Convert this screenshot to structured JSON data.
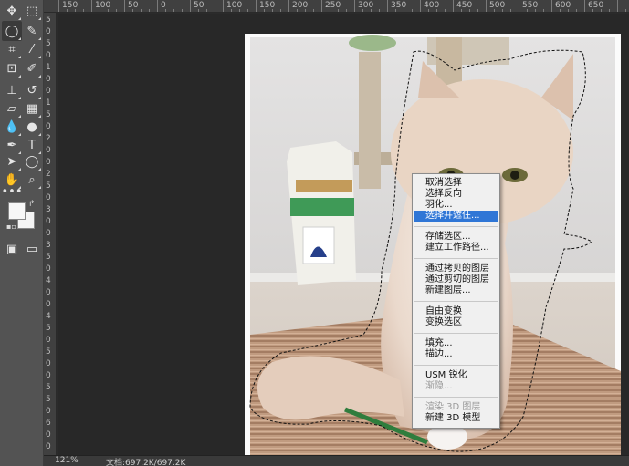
{
  "toolbar": {
    "tools": [
      {
        "name": "move-tool",
        "glyph": "✥"
      },
      {
        "name": "marquee-tool",
        "glyph": "⬚"
      },
      {
        "name": "lasso-tool",
        "glyph": "◯"
      },
      {
        "name": "quick-select-tool",
        "glyph": "✎"
      },
      {
        "name": "crop-tool",
        "glyph": "⌗"
      },
      {
        "name": "eyedropper-tool",
        "glyph": "⁄"
      },
      {
        "name": "healing-tool",
        "glyph": "⊡"
      },
      {
        "name": "brush-tool",
        "glyph": "✐"
      },
      {
        "name": "stamp-tool",
        "glyph": "⊥"
      },
      {
        "name": "history-brush-tool",
        "glyph": "↺"
      },
      {
        "name": "eraser-tool",
        "glyph": "▱"
      },
      {
        "name": "gradient-tool",
        "glyph": "▦"
      },
      {
        "name": "blur-tool",
        "glyph": "💧"
      },
      {
        "name": "dodge-tool",
        "glyph": "●"
      },
      {
        "name": "pen-tool",
        "glyph": "✒"
      },
      {
        "name": "type-tool",
        "glyph": "T"
      },
      {
        "name": "path-select-tool",
        "glyph": "➤"
      },
      {
        "name": "shape-tool",
        "glyph": "◯"
      },
      {
        "name": "hand-tool",
        "glyph": "✋"
      },
      {
        "name": "zoom-tool",
        "glyph": "⌕"
      },
      {
        "name": "more-tools",
        "glyph": "•••"
      },
      {
        "name": "quick-mask-tool",
        "glyph": "▣"
      },
      {
        "name": "screen-mode-tool",
        "glyph": "▭"
      }
    ]
  },
  "ruler": {
    "top_labels": [
      "150",
      "100",
      "50",
      "0",
      "50",
      "100",
      "150",
      "200",
      "250",
      "300",
      "350",
      "400",
      "450",
      "500",
      "550",
      "600",
      "650"
    ],
    "left_labels": [
      "5",
      "0",
      "5",
      "0",
      "1",
      "0",
      "0",
      "1",
      "5",
      "0",
      "2",
      "0",
      "0",
      "2",
      "5",
      "0",
      "3",
      "0",
      "0",
      "3",
      "5",
      "0",
      "4",
      "0",
      "0",
      "4",
      "5",
      "0",
      "5",
      "0",
      "0",
      "5",
      "5",
      "0",
      "6",
      "0",
      "0"
    ]
  },
  "status": {
    "zoom": "121%",
    "doc_info": "文档:697.2K/697.2K"
  },
  "context_menu": {
    "groups": [
      [
        {
          "label": "取消选择",
          "state": "normal"
        },
        {
          "label": "选择反向",
          "state": "normal"
        },
        {
          "label": "羽化...",
          "state": "normal"
        },
        {
          "label": "选择并遮住...",
          "state": "highlighted"
        }
      ],
      [
        {
          "label": "存储选区...",
          "state": "normal"
        },
        {
          "label": "建立工作路径...",
          "state": "normal"
        }
      ],
      [
        {
          "label": "通过拷贝的图层",
          "state": "normal"
        },
        {
          "label": "通过剪切的图层",
          "state": "normal"
        },
        {
          "label": "新建图层...",
          "state": "normal"
        }
      ],
      [
        {
          "label": "自由变换",
          "state": "normal"
        },
        {
          "label": "变换选区",
          "state": "normal"
        }
      ],
      [
        {
          "label": "填充...",
          "state": "normal"
        },
        {
          "label": "描边...",
          "state": "normal"
        }
      ],
      [
        {
          "label": "USM 锐化",
          "state": "normal"
        },
        {
          "label": "渐隐...",
          "state": "disabled"
        }
      ],
      [
        {
          "label": "渲染 3D 图层",
          "state": "disabled"
        },
        {
          "label": "新建 3D 模型",
          "state": "normal"
        }
      ]
    ]
  },
  "colors": {
    "ui_panel": "#535353",
    "canvas_bg": "#282828",
    "highlight": "#2f76d6"
  }
}
